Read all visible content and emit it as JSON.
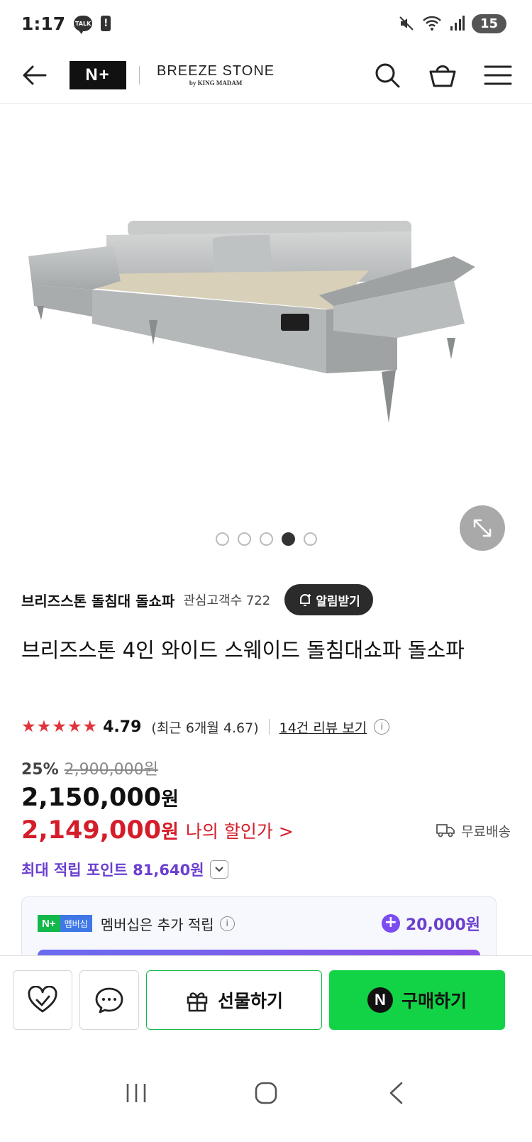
{
  "status_bar": {
    "time": "1:17",
    "talk_label": "TALK",
    "battery_percent": "15"
  },
  "header": {
    "nplus_logo": "N+",
    "brand_name": "BREEZE STONE",
    "brand_sub": "by KING MADAM"
  },
  "gallery": {
    "dot_count": 5,
    "active_index": 3
  },
  "store": {
    "name": "브리즈스톤 돌침대 돌쇼파",
    "interest": "관심고객수 722",
    "alert_label": "알림받기"
  },
  "product": {
    "title": "브리즈스톤 4인 와이드 스웨이드 돌침대쇼파 돌소파",
    "rating": {
      "stars": 5,
      "score": "4.79",
      "recent": "(최근 6개월 4.67)",
      "review_link": "14건 리뷰 보기"
    },
    "price": {
      "discount_rate": "25%",
      "original": "2,900,000원",
      "sale_amount": "2,150,000",
      "currency": "원",
      "my_price_amount": "2,149,000",
      "my_price_label": "나의 할인가 >",
      "shipping": "무료배송",
      "points": "최대 적립 포인트 81,640원"
    }
  },
  "membership": {
    "badge_np": "N+",
    "badge_label": "멤버십",
    "text": "멤버십은 추가 적립",
    "points": "20,000원"
  },
  "actions": {
    "gift_label": "선물하기",
    "buy_label": "구매하기",
    "buy_icon_letter": "N"
  },
  "colors": {
    "accent_green": "#12d345",
    "price_red": "#d51d2a",
    "points_purple": "#6b3fd0",
    "star_red": "#e0343b"
  }
}
